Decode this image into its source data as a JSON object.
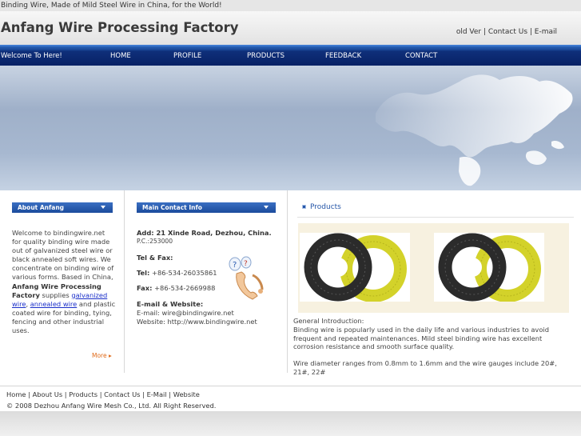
{
  "tagline": "Binding Wire, Made of Mild Steel Wire in China, for the World!",
  "header": {
    "title": "Anfang Wire Processing Factory",
    "links": [
      "old Ver",
      "Contact Us",
      "E-mail"
    ]
  },
  "nav": {
    "welcome": "Welcome To Here!",
    "items": [
      "HOME",
      "PROFILE",
      "PRODUCTS",
      "FEEDBACK",
      "CONTACT"
    ]
  },
  "about": {
    "heading": "About Anfang",
    "text_1": "Welcome to bindingwire.net for quality binding wire made out of galvanized steel wire or black annealed soft wires. We concentrate on binding wire of various forms. Based in China,",
    "company": "Anfang Wire Processing Factory",
    "text_2": "supplies",
    "link_1": "galvanized wire",
    "link_2": "annealed wire",
    "text_3": "and plastic coated wire for binding, tying, fencing and other industrial uses.",
    "more": "More"
  },
  "contact": {
    "heading": "Main Contact Info",
    "address": "Add: 21 Xinde Road, Dezhou, China.",
    "postcode": "P.C.:253000",
    "telfax_label": "Tel & Fax:",
    "tel_label": "Tel:",
    "tel": "+86-534-26035861",
    "fax_label": "Fax:",
    "fax": "+86-534-2669988",
    "email_web_label": "E-mail & Website:",
    "email": "E-mail: wire@bindingwire.net",
    "website": "Website: http://www.bindingwire.net"
  },
  "products": {
    "heading": "Products",
    "intro_title": "General Introduction:",
    "intro_1": "Binding wire is popularly used in the daily life and various industries to avoid frequent and repeated maintenances. Mild steel binding wire has excellent corrosion resistance and smooth surface quality.",
    "intro_2": "Wire diameter ranges from 0.8mm to 1.6mm and the wire gauges include 20#, 21#, 22#"
  },
  "footer": {
    "links": [
      "Home",
      "About Us",
      "Products",
      "Contact Us",
      "E-Mail",
      "Website"
    ],
    "copyright": "© 2008 Dezhou Anfang Wire Mesh Co., Ltd. All Right Reserved."
  },
  "colors": {
    "nav_bg": "#072063",
    "accent_blue": "#2757a8",
    "link_blue": "#1a2fc9",
    "more_orange": "#e06b1a",
    "wire_yellow": "#d6d428",
    "wire_black": "#2a2a2a"
  },
  "icons": [
    "chevron-down-icon",
    "telephone-icon",
    "square-bullet-icon",
    "arrow-right-icon"
  ]
}
